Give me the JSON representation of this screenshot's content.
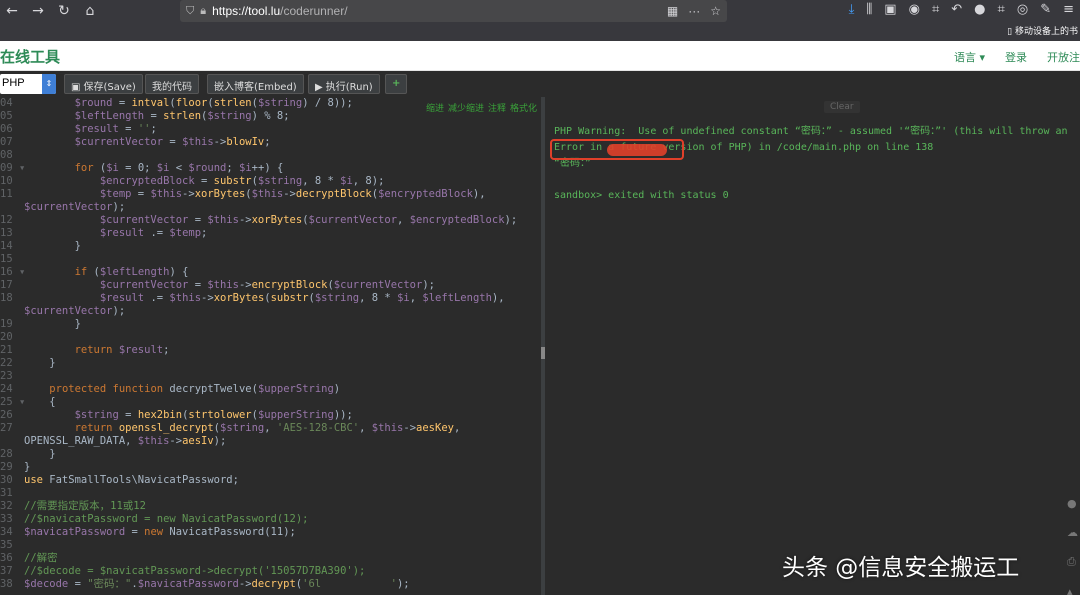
{
  "browser": {
    "url_host": "https://tool.lu",
    "url_path": "/coderunner/",
    "mobile_bookmarks": "移动设备上的书"
  },
  "site": {
    "title": "在线工具",
    "menu": [
      "语言 ▾",
      "登录",
      "开放注"
    ]
  },
  "toolbar": {
    "language": "PHP",
    "save_label": "保存(Save)",
    "mycode_label": "我的代码",
    "embed_label": "嵌入博客(Embed)",
    "run_label": "执行(Run)",
    "add_label": "+"
  },
  "editor_actions": [
    "缩进",
    "减少缩进",
    "注释",
    "格式化"
  ],
  "code_lines": [
    {
      "n": "04",
      "fold": false
    },
    {
      "n": "05",
      "fold": false
    },
    {
      "n": "06",
      "fold": false
    },
    {
      "n": "07",
      "fold": false
    },
    {
      "n": "08",
      "fold": false
    },
    {
      "n": "09",
      "fold": true
    },
    {
      "n": "10",
      "fold": false
    },
    {
      "n": "11",
      "fold": false
    },
    {
      "n": "",
      "fold": false
    },
    {
      "n": "12",
      "fold": false
    },
    {
      "n": "13",
      "fold": false
    },
    {
      "n": "14",
      "fold": false
    },
    {
      "n": "15",
      "fold": false
    },
    {
      "n": "16",
      "fold": true
    },
    {
      "n": "17",
      "fold": false
    },
    {
      "n": "18",
      "fold": false
    },
    {
      "n": "",
      "fold": false
    },
    {
      "n": "19",
      "fold": false
    },
    {
      "n": "20",
      "fold": false
    },
    {
      "n": "21",
      "fold": false
    },
    {
      "n": "22",
      "fold": false
    },
    {
      "n": "23",
      "fold": false
    },
    {
      "n": "24",
      "fold": false
    },
    {
      "n": "25",
      "fold": true
    },
    {
      "n": "26",
      "fold": false
    },
    {
      "n": "27",
      "fold": false
    },
    {
      "n": "",
      "fold": false
    },
    {
      "n": "28",
      "fold": false
    },
    {
      "n": "29",
      "fold": false
    },
    {
      "n": "30",
      "fold": false
    },
    {
      "n": "31",
      "fold": false
    },
    {
      "n": "32",
      "fold": false
    },
    {
      "n": "33",
      "fold": false
    },
    {
      "n": "34",
      "fold": false
    },
    {
      "n": "35",
      "fold": false
    },
    {
      "n": "36",
      "fold": false
    },
    {
      "n": "37",
      "fold": false
    },
    {
      "n": "38",
      "fold": false
    }
  ],
  "code_text": [
    "        $round = intval(floor(strlen($string) / 8));",
    "        $leftLength = strlen($string) % 8;",
    "        $result = '';",
    "        $currentVector = $this->blowIv;",
    "",
    "        for ($i = 0; $i < $round; $i++) {",
    "            $encryptedBlock = substr($string, 8 * $i, 8);",
    "            $temp = $this->xorBytes($this->decryptBlock($encryptedBlock),",
    "$currentVector);",
    "            $currentVector = $this->xorBytes($currentVector, $encryptedBlock);",
    "            $result .= $temp;",
    "        }",
    "",
    "        if ($leftLength) {",
    "            $currentVector = $this->encryptBlock($currentVector);",
    "            $result .= $this->xorBytes(substr($string, 8 * $i, $leftLength),",
    "$currentVector);",
    "        }",
    "",
    "        return $result;",
    "    }",
    "",
    "    protected function decryptTwelve($upperString)",
    "    {",
    "        $string = hex2bin(strtolower($upperString));",
    "        return openssl_decrypt($string, 'AES-128-CBC', $this->aesKey,",
    "OPENSSL_RAW_DATA, $this->aesIv);",
    "    }",
    "}",
    "use FatSmallTools\\NavicatPassword;",
    "",
    "//需要指定版本，11或12",
    "//$navicatPassword = new NavicatPassword(12);",
    "$navicatPassword = new NavicatPassword(11);",
    "",
    "//解密",
    "//$decode = $navicatPassword->decrypt('15057D7BA390');",
    "$decode = \"密码：\".$navicatPassword->decrypt('6l           ');"
  ],
  "output": {
    "clear_label": "Clear",
    "lines": [
      "PHP Warning:  Use of undefined constant “密码：” - assumed '“密码：”' (this will throw an",
      "Error in a future version of PHP) in /code/main.php on line 138",
      "“密码：”",
      "",
      "sandbox> exited with status 0"
    ]
  },
  "watermark": "头条 @信息安全搬运工",
  "colors": {
    "editor_bg": "#2b2b2b",
    "output_text": "#59b65a",
    "highlight_red": "#e0402a",
    "site_green": "#2e8b57"
  }
}
